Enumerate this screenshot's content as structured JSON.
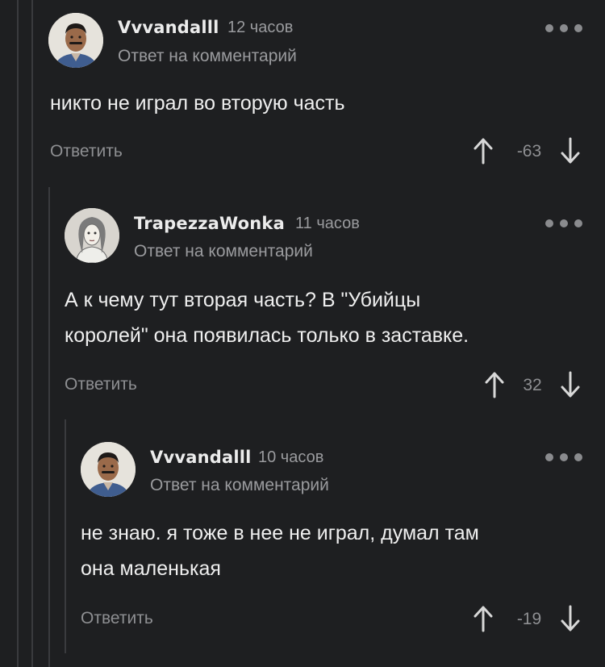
{
  "comments": [
    {
      "author": "Vvvandalll",
      "time": "12 часов",
      "reply_to": "Ответ на комментарий",
      "body_lines": [
        "никто не играл во вторую часть"
      ],
      "reply_label": "Ответить",
      "score": "-63",
      "avatar": "man-with-mustache-avatar"
    },
    {
      "author": "TrapezzaWonka",
      "time": "11 часов",
      "reply_to": "Ответ на комментарий",
      "body_lines": [
        "А к чему тут вторая часть? В \"Убийцы",
        "королей\" она появилась только в заставке."
      ],
      "reply_label": "Ответить",
      "score": "32",
      "avatar": "drawn-woman-avatar"
    },
    {
      "author": "Vvvandalll",
      "time": "10 часов",
      "reply_to": "Ответ на комментарий",
      "body_lines": [
        "не знаю. я тоже в нее не играл, думал там",
        "она маленькая"
      ],
      "reply_label": "Ответить",
      "score": "-19",
      "avatar": "man-with-mustache-avatar"
    }
  ],
  "colors": {
    "background": "#1e1f21",
    "thread_line": "#3a3b3e",
    "muted_text": "#9a9b9e"
  }
}
